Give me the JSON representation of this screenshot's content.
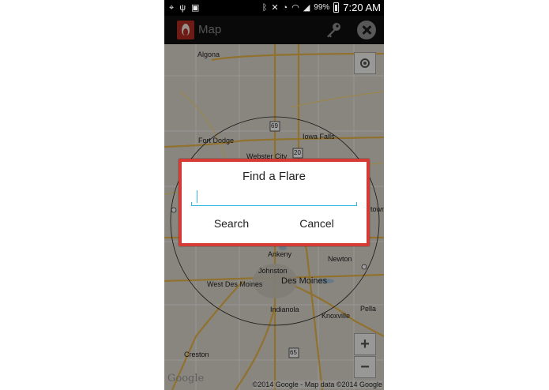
{
  "status_bar": {
    "battery_percent": "99%",
    "time": "7:20 AM",
    "left_icons": [
      "gps-icon",
      "usb-icon",
      "image-icon"
    ],
    "right_icons": [
      "bluetooth-icon",
      "mute-icon",
      "alarm-icon",
      "wifi-icon",
      "signal-icon",
      "battery-icon"
    ]
  },
  "action_bar": {
    "title": "Map",
    "icons": [
      "flare-logo-icon",
      "key-icon",
      "close-icon"
    ]
  },
  "map": {
    "labels": {
      "algona": "Algona",
      "fort_dodge": "Fort Dodge",
      "webster_city": "Webster City",
      "iowa_falls": "Iowa Falls",
      "ankeny": "Ankeny",
      "newton": "Newton",
      "johnston": "Johnston",
      "west_des_moines": "West Des Moines",
      "des_moines": "Des Moines",
      "indianola": "Indianola",
      "knoxville": "Knoxville",
      "pella": "Pella",
      "creston": "Creston",
      "town_partial": "town",
      "route_69": "69",
      "route_20": "20",
      "route_35": "35",
      "route_65": "65"
    },
    "zoom_in_label": "+",
    "zoom_out_label": "−",
    "google_logo": "Google",
    "attribution": "©2014 Google - Map data ©2014 Google"
  },
  "dialog": {
    "title": "Find a Flare",
    "input_value": "",
    "search_label": "Search",
    "cancel_label": "Cancel",
    "highlight_color": "#d63a35",
    "accent_color": "#33b5e5"
  }
}
